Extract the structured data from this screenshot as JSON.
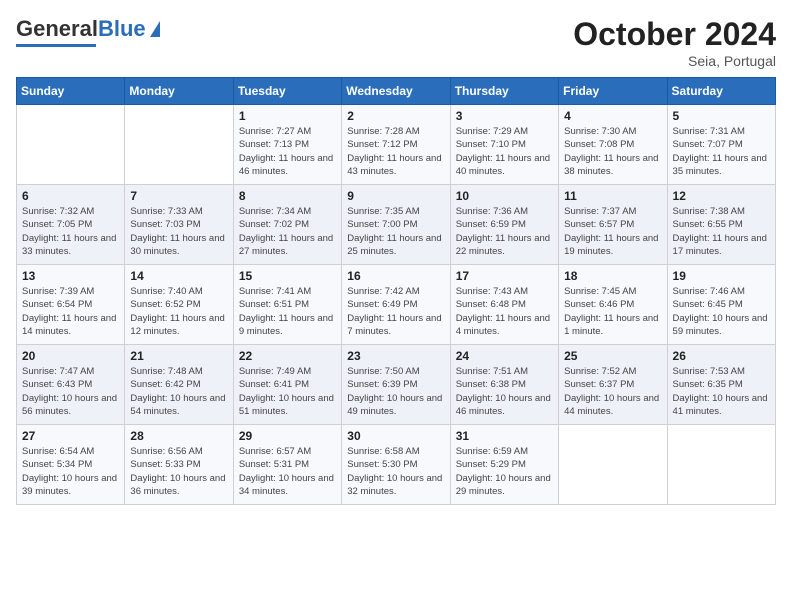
{
  "header": {
    "logo_general": "General",
    "logo_blue": "Blue",
    "month_title": "October 2024",
    "subtitle": "Seia, Portugal"
  },
  "days_of_week": [
    "Sunday",
    "Monday",
    "Tuesday",
    "Wednesday",
    "Thursday",
    "Friday",
    "Saturday"
  ],
  "weeks": [
    [
      {
        "day": "",
        "info": ""
      },
      {
        "day": "",
        "info": ""
      },
      {
        "day": "1",
        "info": "Sunrise: 7:27 AM\nSunset: 7:13 PM\nDaylight: 11 hours and 46 minutes."
      },
      {
        "day": "2",
        "info": "Sunrise: 7:28 AM\nSunset: 7:12 PM\nDaylight: 11 hours and 43 minutes."
      },
      {
        "day": "3",
        "info": "Sunrise: 7:29 AM\nSunset: 7:10 PM\nDaylight: 11 hours and 40 minutes."
      },
      {
        "day": "4",
        "info": "Sunrise: 7:30 AM\nSunset: 7:08 PM\nDaylight: 11 hours and 38 minutes."
      },
      {
        "day": "5",
        "info": "Sunrise: 7:31 AM\nSunset: 7:07 PM\nDaylight: 11 hours and 35 minutes."
      }
    ],
    [
      {
        "day": "6",
        "info": "Sunrise: 7:32 AM\nSunset: 7:05 PM\nDaylight: 11 hours and 33 minutes."
      },
      {
        "day": "7",
        "info": "Sunrise: 7:33 AM\nSunset: 7:03 PM\nDaylight: 11 hours and 30 minutes."
      },
      {
        "day": "8",
        "info": "Sunrise: 7:34 AM\nSunset: 7:02 PM\nDaylight: 11 hours and 27 minutes."
      },
      {
        "day": "9",
        "info": "Sunrise: 7:35 AM\nSunset: 7:00 PM\nDaylight: 11 hours and 25 minutes."
      },
      {
        "day": "10",
        "info": "Sunrise: 7:36 AM\nSunset: 6:59 PM\nDaylight: 11 hours and 22 minutes."
      },
      {
        "day": "11",
        "info": "Sunrise: 7:37 AM\nSunset: 6:57 PM\nDaylight: 11 hours and 19 minutes."
      },
      {
        "day": "12",
        "info": "Sunrise: 7:38 AM\nSunset: 6:55 PM\nDaylight: 11 hours and 17 minutes."
      }
    ],
    [
      {
        "day": "13",
        "info": "Sunrise: 7:39 AM\nSunset: 6:54 PM\nDaylight: 11 hours and 14 minutes."
      },
      {
        "day": "14",
        "info": "Sunrise: 7:40 AM\nSunset: 6:52 PM\nDaylight: 11 hours and 12 minutes."
      },
      {
        "day": "15",
        "info": "Sunrise: 7:41 AM\nSunset: 6:51 PM\nDaylight: 11 hours and 9 minutes."
      },
      {
        "day": "16",
        "info": "Sunrise: 7:42 AM\nSunset: 6:49 PM\nDaylight: 11 hours and 7 minutes."
      },
      {
        "day": "17",
        "info": "Sunrise: 7:43 AM\nSunset: 6:48 PM\nDaylight: 11 hours and 4 minutes."
      },
      {
        "day": "18",
        "info": "Sunrise: 7:45 AM\nSunset: 6:46 PM\nDaylight: 11 hours and 1 minute."
      },
      {
        "day": "19",
        "info": "Sunrise: 7:46 AM\nSunset: 6:45 PM\nDaylight: 10 hours and 59 minutes."
      }
    ],
    [
      {
        "day": "20",
        "info": "Sunrise: 7:47 AM\nSunset: 6:43 PM\nDaylight: 10 hours and 56 minutes."
      },
      {
        "day": "21",
        "info": "Sunrise: 7:48 AM\nSunset: 6:42 PM\nDaylight: 10 hours and 54 minutes."
      },
      {
        "day": "22",
        "info": "Sunrise: 7:49 AM\nSunset: 6:41 PM\nDaylight: 10 hours and 51 minutes."
      },
      {
        "day": "23",
        "info": "Sunrise: 7:50 AM\nSunset: 6:39 PM\nDaylight: 10 hours and 49 minutes."
      },
      {
        "day": "24",
        "info": "Sunrise: 7:51 AM\nSunset: 6:38 PM\nDaylight: 10 hours and 46 minutes."
      },
      {
        "day": "25",
        "info": "Sunrise: 7:52 AM\nSunset: 6:37 PM\nDaylight: 10 hours and 44 minutes."
      },
      {
        "day": "26",
        "info": "Sunrise: 7:53 AM\nSunset: 6:35 PM\nDaylight: 10 hours and 41 minutes."
      }
    ],
    [
      {
        "day": "27",
        "info": "Sunrise: 6:54 AM\nSunset: 5:34 PM\nDaylight: 10 hours and 39 minutes."
      },
      {
        "day": "28",
        "info": "Sunrise: 6:56 AM\nSunset: 5:33 PM\nDaylight: 10 hours and 36 minutes."
      },
      {
        "day": "29",
        "info": "Sunrise: 6:57 AM\nSunset: 5:31 PM\nDaylight: 10 hours and 34 minutes."
      },
      {
        "day": "30",
        "info": "Sunrise: 6:58 AM\nSunset: 5:30 PM\nDaylight: 10 hours and 32 minutes."
      },
      {
        "day": "31",
        "info": "Sunrise: 6:59 AM\nSunset: 5:29 PM\nDaylight: 10 hours and 29 minutes."
      },
      {
        "day": "",
        "info": ""
      },
      {
        "day": "",
        "info": ""
      }
    ]
  ]
}
